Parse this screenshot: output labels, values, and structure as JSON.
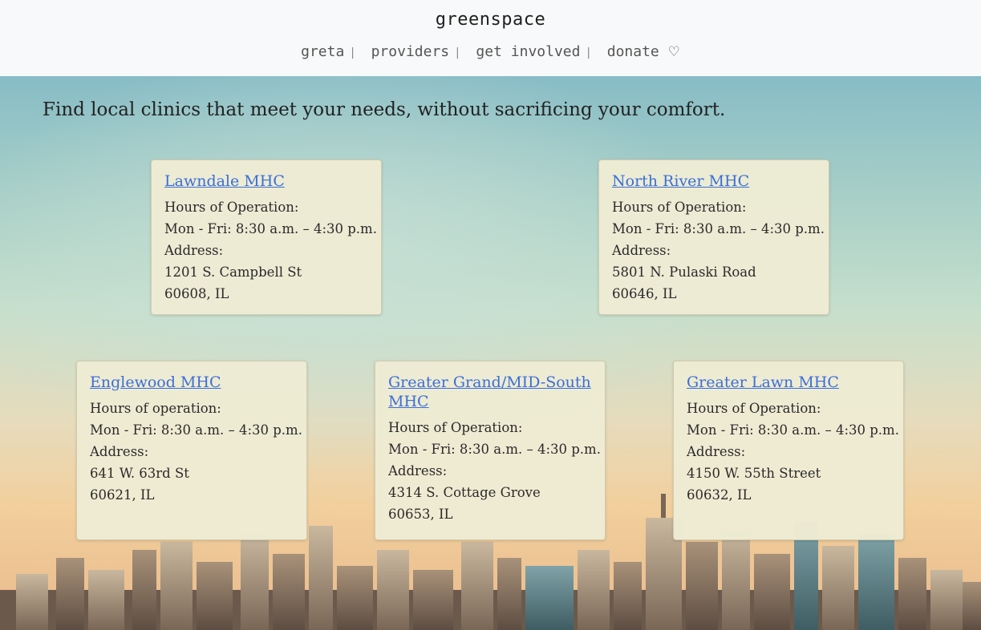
{
  "header": {
    "brand": "greenspace",
    "nav": [
      {
        "label": "greta"
      },
      {
        "label": "providers"
      },
      {
        "label": "get involved"
      },
      {
        "label": "donate",
        "icon": "heart-outline-icon",
        "glyph": "♡"
      }
    ],
    "separator": "|"
  },
  "main": {
    "tagline": "Find local clinics that meet your needs, without sacrificing your comfort.",
    "clinics": [
      {
        "name": "Lawndale MHC",
        "hours_label": "Hours of Operation:",
        "hours": "Mon - Fri: 8:30 a.m. – 4:30 p.m.",
        "address_label": "Address:",
        "street": "1201 S. Campbell St",
        "zip": "60608, IL"
      },
      {
        "name": "North River MHC",
        "hours_label": "Hours of Operation:",
        "hours": "Mon - Fri: 8:30 a.m. – 4:30 p.m.",
        "address_label": "Address:",
        "street": "5801 N. Pulaski Road",
        "zip": "60646, IL"
      },
      {
        "name": "Englewood MHC",
        "hours_label": "Hours of operation:",
        "hours": "Mon - Fri: 8:30 a.m. – 4:30 p.m.",
        "address_label": "Address:",
        "street": "641 W. 63rd St",
        "zip": "60621, IL"
      },
      {
        "name": "Greater Grand/MID-South MHC",
        "hours_label": "Hours of Operation:",
        "hours": "Mon - Fri: 8:30 a.m. – 4:30 p.m.",
        "address_label": "Address:",
        "street": "4314 S. Cottage Grove",
        "zip": "60653, IL"
      },
      {
        "name": "Greater Lawn MHC",
        "hours_label": "Hours of Operation:",
        "hours": "Mon - Fri: 8:30 a.m. – 4:30 p.m.",
        "address_label": "Address:",
        "street": "4150 W. 55th Street",
        "zip": "60632, IL"
      }
    ]
  },
  "colors": {
    "link": "#3a6fd8",
    "card_bg": "#eeebd4",
    "header_bg": "#f8f9fa"
  }
}
